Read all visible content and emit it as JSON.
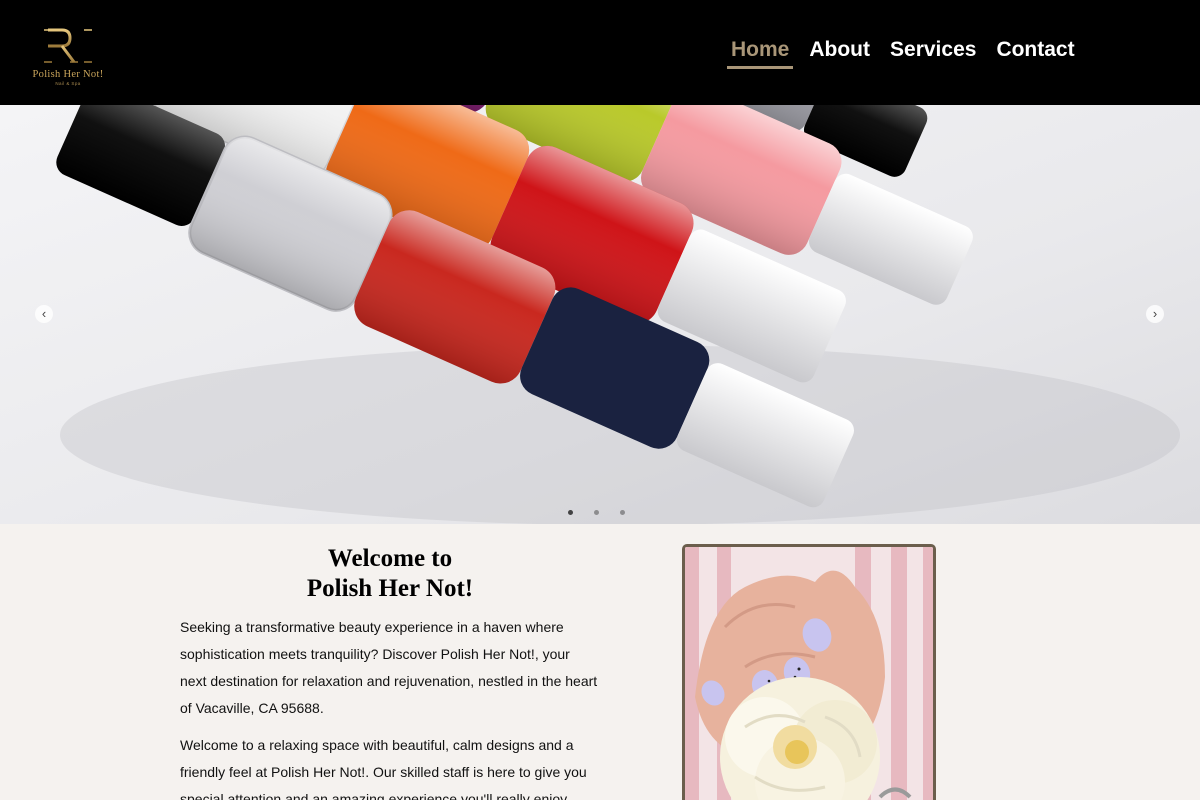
{
  "header": {
    "logo_name": "Polish Her Not!",
    "logo_sub": "Nail & Spa",
    "nav": [
      {
        "label": "Home",
        "active": true
      },
      {
        "label": "About",
        "active": false
      },
      {
        "label": "Services",
        "active": false
      },
      {
        "label": "Contact",
        "active": false
      }
    ]
  },
  "hero": {
    "prev_arrow": "‹",
    "next_arrow": "›",
    "slide_count": 3,
    "active_slide": 1
  },
  "main": {
    "title_line1": "Welcome to",
    "title_line2": "Polish Her Not!",
    "paragraph1": "Seeking a transformative beauty experience in a haven where sophistication meets tranquility? Discover Polish Her Not!, your next destination for relaxation and rejuvenation, nestled in the heart of Vacaville, CA 95688.",
    "paragraph2": "Welcome to a relaxing space with beautiful, calm designs and a friendly feel at Polish Her Not!. Our skilled staff is here to give you special attention and an amazing experience you'll really enjoy. Treat"
  },
  "colors": {
    "header_bg": "#000000",
    "nav_active": "#a99678",
    "nav_text": "#ffffff",
    "page_bg": "#f5f2ef",
    "frame_border": "#6b5e4c",
    "logo_gold": "#c9a45a"
  },
  "icons": {
    "logo": "monogram-logo-icon",
    "prev": "chevron-left-icon",
    "next": "chevron-right-icon"
  }
}
